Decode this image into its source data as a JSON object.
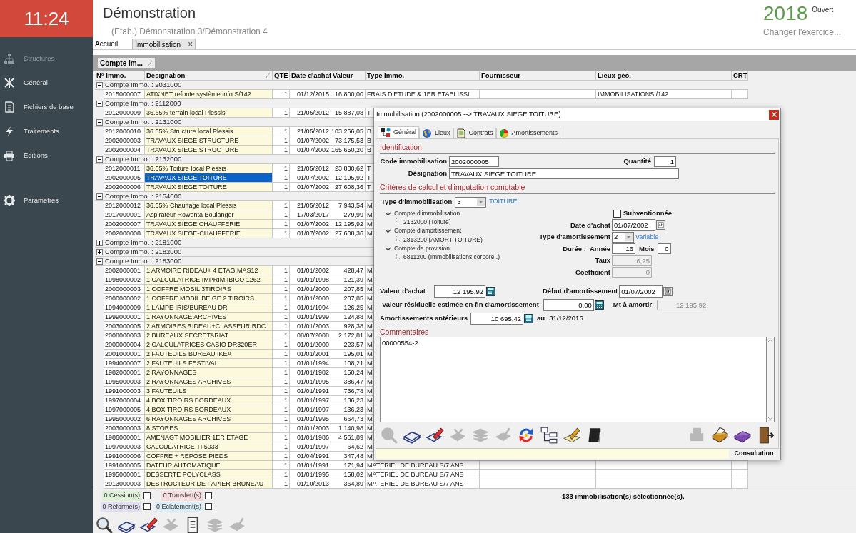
{
  "clock": "11:24",
  "sidebar": {
    "items": [
      {
        "label": "Structures",
        "disabled": true
      },
      {
        "label": "Général",
        "disabled": false
      },
      {
        "label": "Fichiers de base",
        "disabled": false
      },
      {
        "label": "Traitements",
        "disabled": false
      },
      {
        "label": "Editions",
        "disabled": false
      },
      {
        "label": "Paramètres",
        "disabled": false
      }
    ]
  },
  "header": {
    "title": "Démonstration",
    "subtitle": "(Etab.) Démonstration 3/Démonstration 4",
    "year": "2018",
    "status": "Ouvert",
    "change_link": "Changer l'exercice..."
  },
  "tabs": [
    {
      "label": "Accueil",
      "selected": false
    },
    {
      "label": "Immobilisation",
      "selected": true,
      "close": "×"
    }
  ],
  "group_chip": "Compte Im...",
  "table": {
    "columns": [
      "N° Immo.",
      "Désignation",
      "QTE",
      "Date d'achat",
      "Valeur",
      "Type Immo.",
      "Fournisseur",
      "Lieux géo.",
      "CRT"
    ],
    "groups": [
      {
        "label": "Compte Immo. : 2031000",
        "expanded": true,
        "rows": [
          {
            "cells": [
              "2015000007",
              "ATIXNET refonte système info S/142",
              "1",
              "01/12/2015",
              "16 800,00",
              "FRAIS D'ETUDE & 1ER ETABLISSI",
              "",
              "IMMOBILISATIONS /142"
            ],
            "selected": false
          }
        ]
      },
      {
        "label": "Compte Immo. : 2112000",
        "expanded": true,
        "rows": [
          {
            "cells": [
              "2012000009",
              "36.65% terrain local Plessis",
              "1",
              "21/05/2012",
              "15 887,08",
              "T"
            ],
            "selected": false
          }
        ]
      },
      {
        "label": "Compte Immo. : 2131000",
        "expanded": true,
        "rows": [
          {
            "cells": [
              "2012000010",
              "36.65% Structure local Plessis",
              "1",
              "21/05/2012",
              "103 266,05",
              "B"
            ],
            "selected": false
          },
          {
            "cells": [
              "2002000003",
              "TRAVAUX SIEGE STRUCTURE",
              "1",
              "01/07/2002",
              "73 175,53",
              "B"
            ],
            "selected": false
          },
          {
            "cells": [
              "2002000004",
              "TRAVAUX SIEGE STRUCTURE",
              "1",
              "01/07/2002",
              "165 650,20",
              "B"
            ],
            "selected": false
          }
        ]
      },
      {
        "label": "Compte Immo. : 2132000",
        "expanded": true,
        "rows": [
          {
            "cells": [
              "2012000011",
              "36.65% Toiture local Plessis",
              "1",
              "21/05/2012",
              "23 830,62",
              "T"
            ],
            "selected": false
          },
          {
            "cells": [
              "2002000005",
              "TRAVAUX SIEGE TOITURE",
              "1",
              "01/07/2002",
              "12 195,92",
              "T"
            ],
            "selected": true
          },
          {
            "cells": [
              "2002000006",
              "TRAVAUX SIEGE TOITURE",
              "1",
              "01/07/2002",
              "27 608,36",
              "T"
            ],
            "selected": false
          }
        ]
      },
      {
        "label": "Compte Immo. : 2154000",
        "expanded": true,
        "rows": [
          {
            "cells": [
              "2012000012",
              "36.65% Chauffage local Plessis",
              "1",
              "21/05/2012",
              "7 943,54",
              "M"
            ],
            "selected": false
          },
          {
            "cells": [
              "2017000001",
              "Aspirateur Rowenta Boulanger",
              "1",
              "17/03/2017",
              "279,99",
              "M"
            ],
            "selected": false
          },
          {
            "cells": [
              "2002000007",
              "TRAVAUX SIEGE CHAUFFERIE",
              "1",
              "01/07/2002",
              "12 195,92",
              "M"
            ],
            "selected": false
          },
          {
            "cells": [
              "2002000008",
              "TRAVAUX SIEGE-CHAUFFERIE",
              "1",
              "01/07/2002",
              "27 608,36",
              "M"
            ],
            "selected": false
          }
        ]
      },
      {
        "label": "Compte Immo. : 2181000",
        "expanded": false
      },
      {
        "label": "Compte Immo. : 2182000",
        "expanded": false
      },
      {
        "label": "Compte Immo. : 2183000",
        "expanded": true,
        "rows": [
          {
            "cells": [
              "2002000001",
              "1 ARMOIRE RIDEAU+ 4 ETAG.MAS12",
              "1",
              "01/01/2002",
              "428,47",
              "M"
            ],
            "selected": false
          },
          {
            "cells": [
              "1998000002",
              "1 CALCULATRICE IMPRIM IBICO 1262",
              "1",
              "01/01/1998",
              "121,39",
              "M"
            ],
            "selected": false
          },
          {
            "cells": [
              "2000000003",
              "1 COFFRE MOBIL 3TIROIRS",
              "1",
              "01/01/2000",
              "207,85",
              "M"
            ],
            "selected": false
          },
          {
            "cells": [
              "2000000002",
              "1 COFFRE MOBIL BEIGE 2 TIROIRS",
              "1",
              "01/01/2000",
              "207,85",
              "M"
            ],
            "selected": false
          },
          {
            "cells": [
              "1994000009",
              "1 LAMPE IRIS/BUREAU DR",
              "1",
              "01/01/1994",
              "126,25",
              "M"
            ],
            "selected": false
          },
          {
            "cells": [
              "1999000001",
              "1 RAYONNAGE ARCHIVES",
              "1",
              "01/01/1999",
              "124,88",
              "M"
            ],
            "selected": false
          },
          {
            "cells": [
              "2003000005",
              "2 ARMOIRES RIDEAU+CLASSEUR RDC",
              "1",
              "01/01/2003",
              "928,38",
              "M"
            ],
            "selected": false
          },
          {
            "cells": [
              "2008000003",
              "2 BUREAUX SECRETARIAT",
              "1",
              "08/07/2008",
              "2 172,81",
              "M"
            ],
            "selected": false
          },
          {
            "cells": [
              "2000000004",
              "2 CALCULATRICES CASIO DR320ER",
              "1",
              "01/01/2000",
              "223,57",
              "M"
            ],
            "selected": false
          },
          {
            "cells": [
              "2001000001",
              "2 FAUTEUILS BUREAU IKEA",
              "1",
              "01/01/2001",
              "195,01",
              "M"
            ],
            "selected": false
          },
          {
            "cells": [
              "1994000007",
              "2 FAUTEUILS FESTIVAL",
              "1",
              "01/01/1994",
              "108,21",
              "M"
            ],
            "selected": false
          },
          {
            "cells": [
              "1982000001",
              "2 RAYONNAGES",
              "1",
              "01/01/1982",
              "150,24",
              "M"
            ],
            "selected": false
          },
          {
            "cells": [
              "1995000003",
              "2 RAYONNAGES ARCHIVES",
              "1",
              "01/01/1995",
              "386,47",
              "M"
            ],
            "selected": false
          },
          {
            "cells": [
              "1991000003",
              "3 FAUTEUILS",
              "1",
              "01/01/1991",
              "736,78",
              "M"
            ],
            "selected": false
          },
          {
            "cells": [
              "1997000004",
              "4 BOX TIROIRS BORDEAUX",
              "1",
              "01/01/1997",
              "136,23",
              "M"
            ],
            "selected": false
          },
          {
            "cells": [
              "1997000005",
              "4 BOX TIROIRS BORDEAUX",
              "1",
              "01/01/1997",
              "136,23",
              "M"
            ],
            "selected": false
          },
          {
            "cells": [
              "1995000002",
              "6 RAYONNAGES ARCHIVES",
              "1",
              "01/01/1995",
              "664,73",
              "M"
            ],
            "selected": false
          },
          {
            "cells": [
              "2003000003",
              "8 STORES",
              "1",
              "01/01/2003",
              "1 140,98",
              "M"
            ],
            "selected": false
          },
          {
            "cells": [
              "1986000001",
              "AMENAGT MOBILIER 1ER ETAGE",
              "1",
              "01/01/1986",
              "4 561,89",
              "M"
            ],
            "selected": false
          },
          {
            "cells": [
              "1997000003",
              "CALCULATRICE TI 5033",
              "1",
              "01/01/1997",
              "64,62",
              "M"
            ],
            "selected": false
          },
          {
            "cells": [
              "1991000006",
              "COFFRE + REPOSE PIEDS",
              "1",
              "01/04/1991",
              "347,48",
              "M"
            ],
            "selected": false
          },
          {
            "cells": [
              "1991000005",
              "DATEUR AUTOMATIQUE",
              "1",
              "01/01/1991",
              "171,94",
              "MATERIEL DE BUREAU S/7 ANS"
            ],
            "selected": false
          },
          {
            "cells": [
              "1995000001",
              "DESSERTE POLYCLASS",
              "1",
              "01/01/1995",
              "158,02",
              "MATERIEL DE BUREAU S/7 ANS"
            ],
            "selected": false
          },
          {
            "cells": [
              "2013000003",
              "DESTRUCTEUR DE PAPIER BRUNEAU",
              "1",
              "01/10/2013",
              "364,89",
              "MATERIEL DE BUREAU S/7 ANS"
            ],
            "selected": false
          }
        ]
      }
    ]
  },
  "flags": [
    {
      "label": "0 Cession(s)",
      "checked": false,
      "color": "#dff0d8"
    },
    {
      "label": "0 Transfert(s)",
      "checked": false,
      "color": "#f7dede"
    },
    {
      "label": "0 Réforme(s)",
      "checked": false,
      "color": "#e4e0f4"
    },
    {
      "label": "0 Eclatement(s)",
      "checked": false,
      "color": "#d9eef7"
    }
  ],
  "selection_count": "133 immobilisation(s) sélectionnée(s).",
  "toolbar": [
    {
      "disabled": false
    },
    {
      "disabled": false
    },
    {
      "disabled": false
    },
    {
      "disabled": true
    },
    {
      "disabled": false
    },
    {
      "disabled": true
    },
    {
      "disabled": true
    }
  ],
  "dialog": {
    "title": "Immobilisation (2002000005 --> TRAVAUX SIEGE TOITURE)",
    "tabs": [
      {
        "label": "Général",
        "selected": true
      },
      {
        "label": "Lieux",
        "selected": false
      },
      {
        "label": "Contrats",
        "selected": false
      },
      {
        "label": "Amortissements",
        "selected": false
      }
    ],
    "identification": {
      "heading": "Identification",
      "code": {
        "label": "Code immobilisation",
        "value": "2002000005"
      },
      "quantity": {
        "label": "Quantité",
        "value": "1"
      },
      "designation": {
        "label": "Désignation",
        "value": "TRAVAUX SIEGE TOITURE"
      }
    },
    "criteria": {
      "heading": "Critères de calcul et d'imputation comptable",
      "type": {
        "label": "Type d'immobilisation",
        "value": "3",
        "link": "TOITURE"
      },
      "accounts": [
        {
          "label": "Compte d'immobilisation",
          "expanded": true,
          "children": [
            {
              "label": "2132000 (Toiture)"
            }
          ]
        },
        {
          "label": "Compte d'amortissement",
          "expanded": true,
          "children": [
            {
              "label": "2813200 (AMORT TOITURE)"
            }
          ]
        },
        {
          "label": "Compte de provision",
          "expanded": true,
          "children": [
            {
              "label": "6811200 (Immobilisations corpore..)"
            }
          ]
        }
      ],
      "subsidized": {
        "label": "Subventionnée",
        "checked": false
      },
      "purchase_date": {
        "label": "Date d'achat",
        "value": "01/07/2002"
      },
      "amort_type": {
        "label": "Type d'amortissement",
        "value": "2",
        "link": "Variable"
      },
      "duration": {
        "label": "Durée :",
        "year_label": "Année",
        "years": "16",
        "month_label": "Mois",
        "months": "0"
      },
      "rate": {
        "label": "Taux",
        "value": "6,25",
        "disabled": true
      },
      "coefficient": {
        "label": "Coefficient",
        "value": "0",
        "disabled": true
      },
      "purchase_value": {
        "label": "Valeur d'achat",
        "value": "12 195,92"
      },
      "amort_start": {
        "label": "Début d'amortissement",
        "value": "01/07/2002"
      },
      "residual": {
        "label": "Valeur résiduelle estimée en fin d'amortissement",
        "value": "0,00"
      },
      "to_amortize": {
        "label": "Mt à amortir",
        "value": "12 195,92",
        "disabled": true
      },
      "prior": {
        "label": "Amortissements antérieurs",
        "value": "10 695,42",
        "at_label": "au",
        "at_date": "31/12/2016"
      }
    },
    "comments": {
      "heading": "Commentaires",
      "value": "00000554-2"
    },
    "toolbar": [
      {
        "disabled": true
      },
      {
        "disabled": false
      },
      {
        "disabled": false
      },
      {
        "disabled": true
      },
      {
        "disabled": true
      },
      {
        "disabled": true
      },
      {
        "disabled": false
      },
      {
        "disabled": false
      },
      {
        "disabled": false
      },
      {
        "disabled": false
      }
    ],
    "toolbar_right": [
      {
        "disabled": true
      },
      {
        "disabled": false
      },
      {
        "disabled": false
      },
      {
        "disabled": false
      }
    ],
    "status": "Consultation"
  }
}
